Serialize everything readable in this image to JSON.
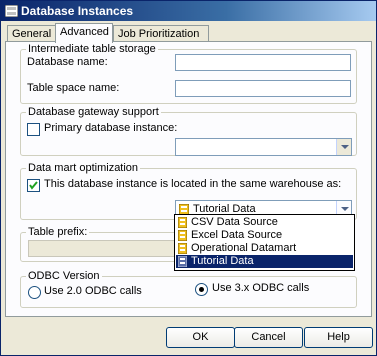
{
  "window": {
    "title": "Database Instances"
  },
  "tabs": [
    {
      "label": "General"
    },
    {
      "label": "Advanced"
    },
    {
      "label": "Job Prioritization"
    }
  ],
  "intermediate": {
    "group_title": "Intermediate table storage",
    "db_name_label": "Database name:",
    "db_name_value": "",
    "tablespace_label": "Table space name:",
    "tablespace_value": ""
  },
  "gateway": {
    "group_title": "Database gateway support",
    "primary_label": "Primary database instance:",
    "primary_checked": false,
    "primary_value": ""
  },
  "datamart": {
    "group_title": "Data mart optimization",
    "same_wh_label": "This database instance is located in the same warehouse as:",
    "same_wh_checked": true,
    "selected": "Tutorial Data",
    "options": [
      "CSV Data Source",
      "Excel Data Source",
      "Operational Datamart",
      "Tutorial Data"
    ]
  },
  "table_prefix": {
    "label": "Table prefix:",
    "value": ""
  },
  "odbc": {
    "group_title": "ODBC Version",
    "opt20": "Use 2.0 ODBC calls",
    "opt3x": "Use 3.x ODBC calls",
    "selected": "opt3x"
  },
  "buttons": {
    "ok": "OK",
    "cancel": "Cancel",
    "help": "Help"
  },
  "colors": {
    "title_bar": "#0a246a",
    "selection": "#0a246a",
    "dialog_bg": "#ece9d8"
  }
}
